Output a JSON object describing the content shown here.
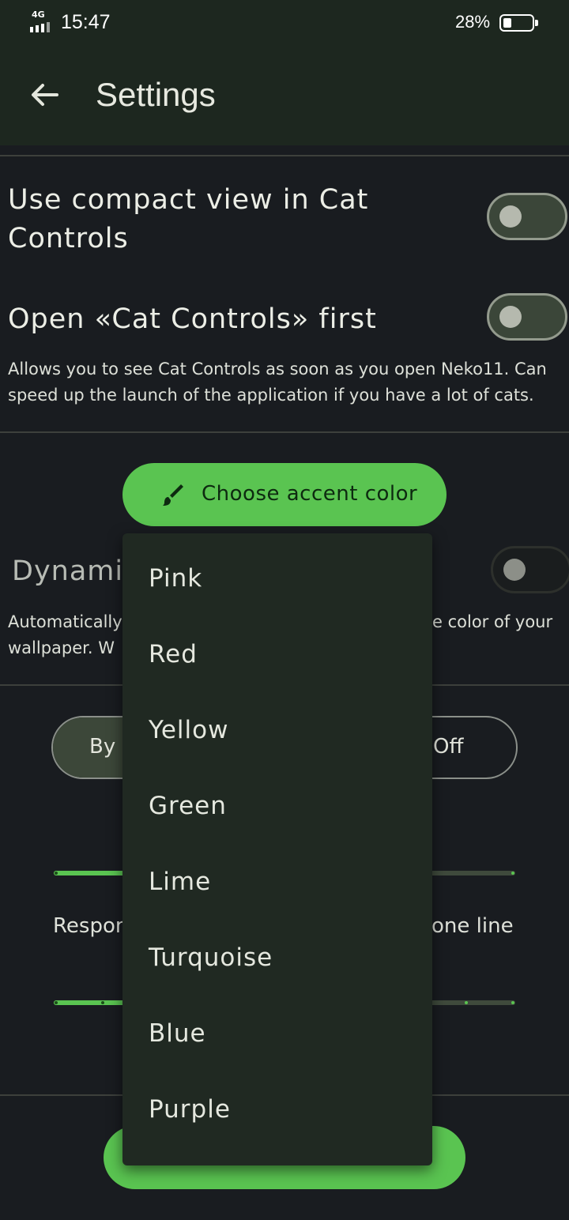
{
  "status_bar": {
    "network": "4G",
    "time": "15:47",
    "battery_percent": "28%",
    "battery_level": 0.28
  },
  "app_bar": {
    "title": "Settings",
    "back_icon": "arrow-back-icon"
  },
  "settings": {
    "compact_view": {
      "title_line1": "Use compact view in Cat",
      "title_line2": "Controls",
      "enabled": false
    },
    "open_cat_controls": {
      "title": "Open «Cat Controls» first",
      "desc_line1": "Allows you to see Cat Controls as soon as you open Neko11. Can",
      "desc_line2": "speed up the launch of the application if you have a lot of cats.",
      "enabled": false
    },
    "accent_button": {
      "label": "Choose accent color",
      "icon": "paintbrush-icon"
    },
    "dynamic": {
      "title_visible": "Dynamic",
      "desc_line1_left": "Automatically",
      "desc_line1_right": "e color of your",
      "desc_line2_left": "wallpaper. W",
      "enabled": false
    },
    "theme_segment": {
      "left_visible": "By",
      "right": "Off"
    },
    "slider_label": {
      "left_visible": "Respon",
      "right_visible": "one line"
    }
  },
  "accent_menu": {
    "items": [
      "Pink",
      "Red",
      "Yellow",
      "Green",
      "Lime",
      "Turquoise",
      "Blue",
      "Purple"
    ]
  },
  "colors": {
    "accent": "#5ac451",
    "background": "#191c20",
    "app_bar": "#1d271f",
    "menu": "#202922"
  }
}
